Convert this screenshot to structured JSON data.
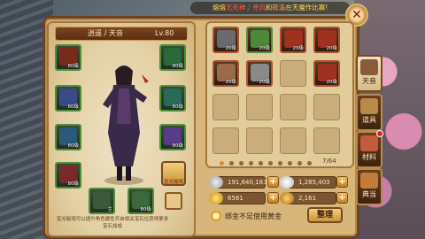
{
  "notice": {
    "before": "熔熔",
    "red1": "无死神丿寻风",
    "mid": "和",
    "orange": "筱溪",
    "after": "在天魔作比赛!"
  },
  "player": {
    "name": "逍遥丿天音",
    "level": "Lv.80"
  },
  "equip_slots": [
    {
      "name": "weapon",
      "tag": "80级",
      "color": "#7a2a1a"
    },
    {
      "name": "necklace",
      "tag": "80级",
      "color": "#2a6a3a"
    },
    {
      "name": "armor",
      "tag": "80级",
      "color": "#3a4a8a"
    },
    {
      "name": "bracer",
      "tag": "80级",
      "color": "#2a6a5a"
    },
    {
      "name": "pants",
      "tag": "80级",
      "color": "#2a5a7a"
    },
    {
      "name": "belt",
      "tag": "80级",
      "color": "#5a3a8a"
    },
    {
      "name": "boots",
      "tag": "80级",
      "color": "#7a2a2a"
    },
    {
      "name": "ring",
      "tag": "80级",
      "color": "#3a6a2a"
    },
    {
      "name": "amulet",
      "tag": "主",
      "color": "#3a5a3a"
    },
    {
      "name": "jade",
      "tag": "80级",
      "color": "#3a6a3a"
    }
  ],
  "gear_button": "宝光秘戏",
  "hint": "宝光秘戏可以提升角色属性开启相关宝石位获得更多宝石加成",
  "bag": {
    "items": [
      {
        "tag": "20级",
        "color": "#6a6a6a",
        "type": "item"
      },
      {
        "tag": "20级",
        "color": "#4a8a3a",
        "type": "item green"
      },
      {
        "tag": "20级",
        "color": "#a03020",
        "type": "item"
      },
      {
        "tag": "20级",
        "color": "#a03020",
        "type": "item"
      },
      {
        "tag": "20级",
        "color": "#9a6a4a",
        "type": "item"
      },
      {
        "tag": "20级",
        "color": "#8a8a8a",
        "type": "item"
      },
      {
        "tag": "",
        "color": "",
        "type": "empty"
      },
      {
        "tag": "20级",
        "color": "#a03020",
        "type": "item"
      }
    ],
    "count": "7/64",
    "page_count": 10,
    "active_page": 0
  },
  "currency": {
    "silver": "191,640,183",
    "copper": "1,285,403",
    "gold": "6581",
    "bound_gold": "2,161"
  },
  "checkbox_label": "绑金不足使用黄金",
  "sort_button": "整理",
  "tabs": [
    {
      "label": "天音",
      "active": true,
      "badge": false
    },
    {
      "label": "道具",
      "active": false,
      "badge": false
    },
    {
      "label": "材料",
      "active": false,
      "badge": true
    },
    {
      "label": "典当",
      "active": false,
      "badge": false
    }
  ],
  "colors": {
    "frame": "#d7b67c",
    "accent": "#e28a2a",
    "item_border": "#b0502b",
    "equip_border": "#4d8f3a"
  }
}
